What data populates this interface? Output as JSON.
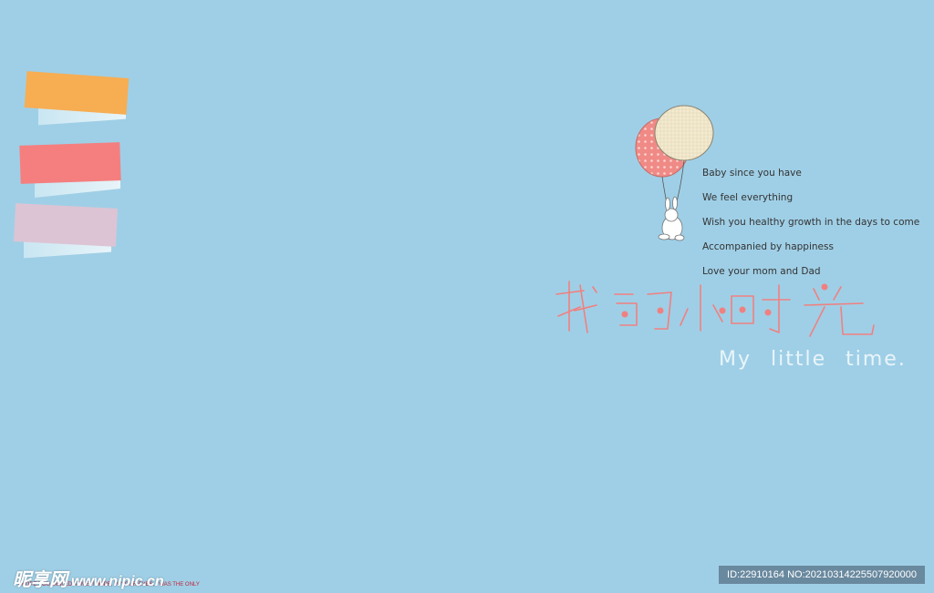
{
  "poem": {
    "lines": [
      "Baby since you have",
      "We feel everything",
      "Wish you healthy growth in the days to come",
      "Accompanied by happiness",
      "Love your mom and Dad"
    ]
  },
  "title": {
    "chinese": "我的小时光",
    "english": "My little time."
  },
  "footer": {
    "tagline": "I HOPE YOU SMILED AT ME.  I HOPE, IN YOUR EYES, I WAS THE ONLY"
  },
  "watermark": {
    "site_name": "昵享网",
    "site_url": "www.nipic.cn",
    "id_text": "ID:22910164 NO:20210314225507920000"
  },
  "colors": {
    "background": "#9fcfe6",
    "note_orange": "#f7ad52",
    "note_red": "#f57f7f",
    "note_pink": "#dcc4d4",
    "title_pink": "#f08080"
  }
}
